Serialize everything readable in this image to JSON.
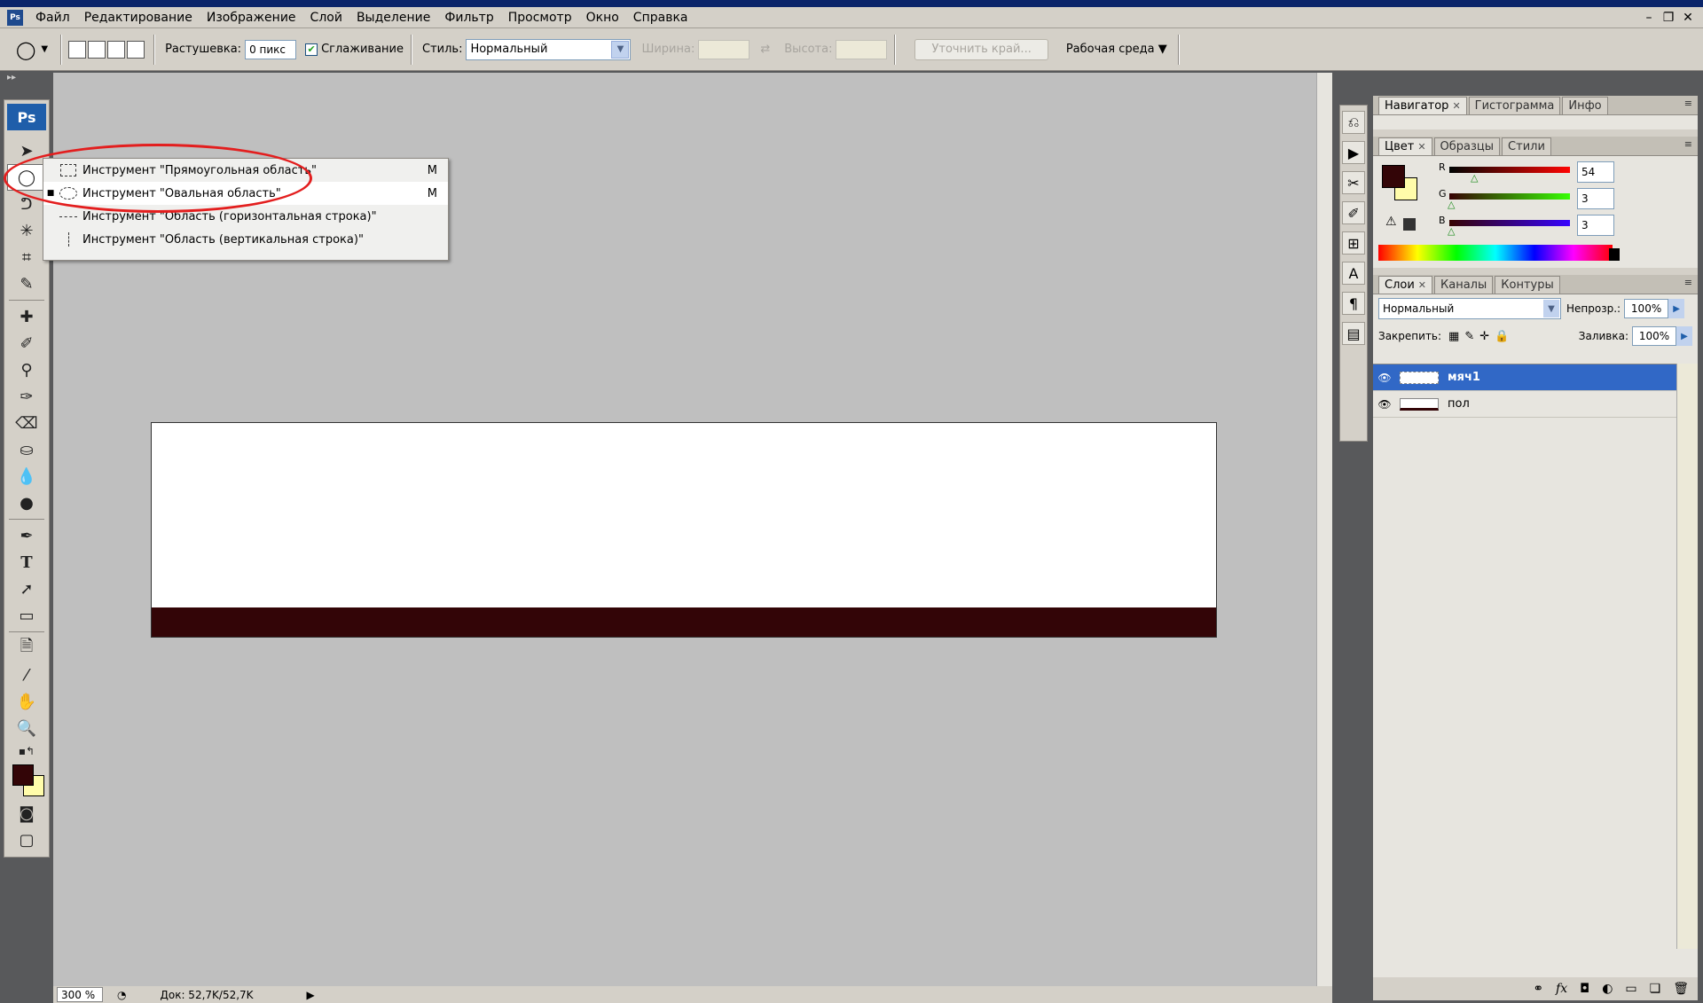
{
  "app": {
    "icon": "Ps",
    "brand_logo": "Ps"
  },
  "menu": [
    "Файл",
    "Редактирование",
    "Изображение",
    "Слой",
    "Выделение",
    "Фильтр",
    "Просмотр",
    "Окно",
    "Справка"
  ],
  "options": {
    "feather_label": "Растушевка:",
    "feather_value": "0 пикс",
    "antialias_label": "Сглаживание",
    "antialias_checked": true,
    "style_label": "Стиль:",
    "style_value": "Нормальный",
    "width_label": "Ширина:",
    "height_label": "Высота:",
    "refine_edge_label": "Уточнить край...",
    "workspace_label": "Рабочая среда"
  },
  "flyout": {
    "items": [
      {
        "label": "Инструмент \"Прямоугольная область\"",
        "key": "M",
        "selected": false
      },
      {
        "label": "Инструмент \"Овальная область\"",
        "key": "M",
        "selected": true
      },
      {
        "label": "Инструмент \"Область (горизонтальная строка)\"",
        "key": "",
        "selected": false
      },
      {
        "label": "Инструмент \"Область (вертикальная строка)\"",
        "key": "",
        "selected": false
      }
    ]
  },
  "panels": {
    "top_tabs": [
      "Навигатор",
      "Гистограмма",
      "Инфо"
    ],
    "color_tabs": [
      "Цвет",
      "Образцы",
      "Стили"
    ],
    "color": {
      "r_label": "R",
      "g_label": "G",
      "b_label": "B",
      "r": "54",
      "g": "3",
      "b": "3",
      "foreground": "#330507",
      "background": "#fffcaa"
    },
    "layer_tabs": [
      "Слои",
      "Каналы",
      "Контуры"
    ],
    "layers": {
      "blend_mode": "Нормальный",
      "opacity_label": "Непрозр.:",
      "opacity": "100%",
      "lock_label": "Закрепить:",
      "fill_label": "Заливка:",
      "fill": "100%",
      "items": [
        {
          "name": "мяч1",
          "active": true
        },
        {
          "name": "пол",
          "active": false
        }
      ]
    }
  },
  "status": {
    "zoom": "300 %",
    "doc": "Док: 52,7K/52,7K"
  },
  "colors": {
    "accent": "#3168c6",
    "ring": "#e31e1e",
    "floor": "#330507",
    "canvas_bg": "#bfbfbf"
  }
}
